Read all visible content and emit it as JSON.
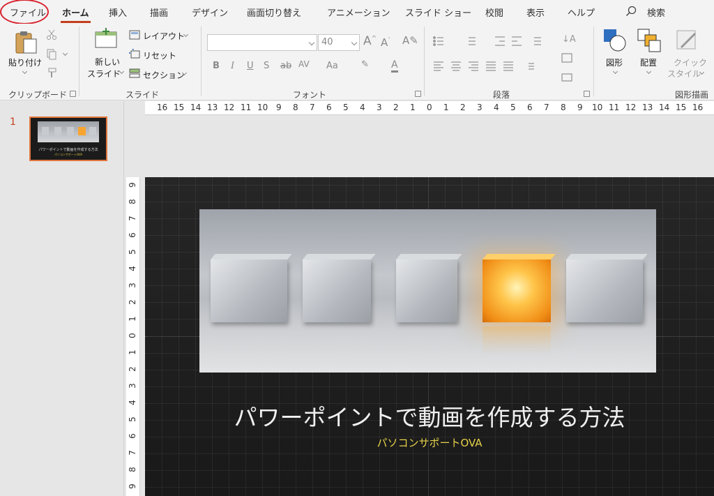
{
  "tabs": {
    "file": "ファイル",
    "home": "ホーム",
    "insert": "挿入",
    "draw": "描画",
    "design": "デザイン",
    "transitions": "画面切り替え",
    "animations": "アニメーション",
    "slideshow": "スライド ショー",
    "review": "校閲",
    "view": "表示",
    "help": "ヘルプ",
    "search": "検索"
  },
  "ribbon": {
    "clipboard": {
      "paste": "貼り付け",
      "label": "クリップボード"
    },
    "slides": {
      "new_slide_line1": "新しい",
      "new_slide_line2": "スライド",
      "layout": "レイアウト",
      "reset": "リセット",
      "section": "セクション",
      "label": "スライド"
    },
    "font": {
      "family": "",
      "size": "40",
      "label": "フォント"
    },
    "paragraph": {
      "label": "段落"
    },
    "drawing": {
      "shapes": "図形",
      "arrange": "配置",
      "quick_styles_line1": "クイック",
      "quick_styles_line2": "スタイル",
      "label": "図形描画"
    }
  },
  "slide_pane": {
    "number": "1"
  },
  "rulers": {
    "horizontal": [
      "16",
      "15",
      "14",
      "13",
      "12",
      "11",
      "10",
      "9",
      "8",
      "7",
      "6",
      "5",
      "4",
      "3",
      "2",
      "1",
      "0",
      "1",
      "2",
      "3",
      "4",
      "5",
      "6",
      "7",
      "8",
      "9",
      "10",
      "11",
      "12",
      "13",
      "14",
      "15",
      "16"
    ],
    "vertical": [
      "9",
      "8",
      "7",
      "6",
      "5",
      "4",
      "3",
      "2",
      "1",
      "0",
      "1",
      "2",
      "3",
      "4",
      "5",
      "6",
      "7",
      "8",
      "9"
    ]
  },
  "slide": {
    "title": "パワーポイントで動画を作成する方法",
    "subtitle": "パソコンサポートOVA"
  },
  "colors": {
    "accent": "#c43e1c",
    "file_circle": "#d9232e",
    "subtitle": "#e6d24a"
  }
}
